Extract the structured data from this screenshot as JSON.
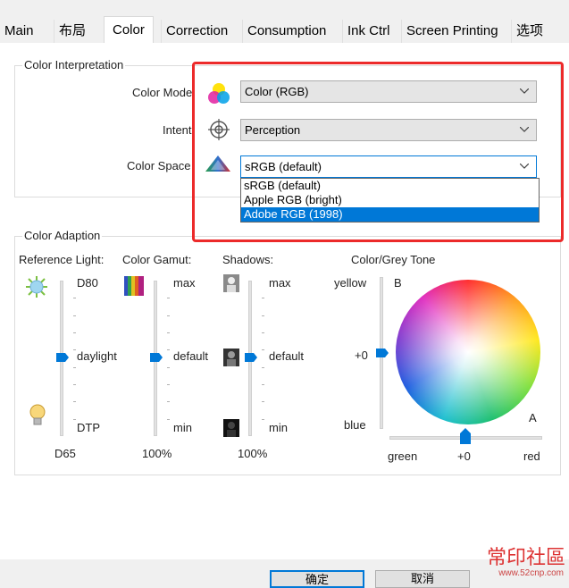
{
  "tabs": [
    "Main",
    "布局",
    "Color",
    "Correction",
    "Consumption",
    "Ink Ctrl",
    "Screen Printing",
    "选项"
  ],
  "interpretation": {
    "legend": "Color Interpretation",
    "color_mode_label": "Color Mode",
    "color_mode_value": "Color (RGB)",
    "intent_label": "Intent",
    "intent_value": "Perception",
    "color_space_label": "Color Space",
    "color_space_value": "sRGB (default)",
    "color_space_options": [
      "sRGB (default)",
      "Apple RGB (bright)",
      "Adobe RGB (1998)"
    ],
    "color_space_highlighted": "Adobe RGB (1998)"
  },
  "adaption": {
    "legend": "Color Adaption",
    "reference_light": {
      "label": "Reference Light:",
      "top": "D80",
      "mid": "daylight",
      "bottom": "DTP",
      "value": "D65",
      "level": 0.5
    },
    "color_gamut": {
      "label": "Color Gamut:",
      "top": "max",
      "mid": "default",
      "bottom": "min",
      "value": "100%",
      "level": 0.5
    },
    "shadows": {
      "label": "Shadows:",
      "top": "max",
      "mid": "default",
      "bottom": "min",
      "value": "100%",
      "level": 0.5
    },
    "grey_tone": {
      "label": "Color/Grey Tone",
      "yellow": "yellow",
      "plus0_v": "+0",
      "blue": "blue",
      "b": "B",
      "a": "A",
      "green": "green",
      "plus0_h": "+0",
      "red": "red",
      "level_v": 0.5,
      "level_h": 0.5
    }
  },
  "buttons": {
    "ok": "确定",
    "cancel": "取消"
  },
  "watermark": {
    "text": "常印社區",
    "url": "www.52cnp.com"
  },
  "colors": {
    "accent": "#0078d7",
    "highlight_box": "#ec2a2a",
    "selection": "#0078d7"
  }
}
